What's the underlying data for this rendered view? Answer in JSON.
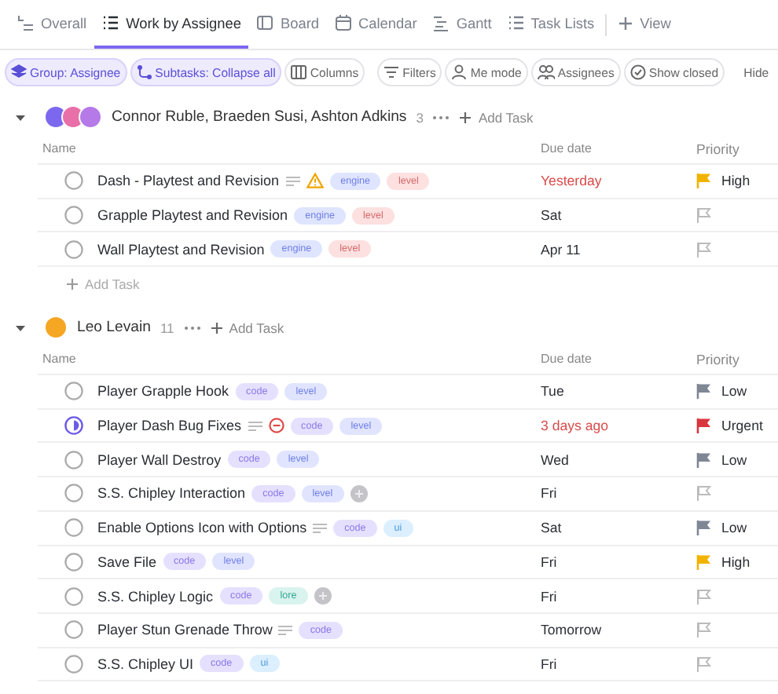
{
  "tabs": [
    {
      "label": "Overall",
      "selected": false
    },
    {
      "label": "Work by Assignee",
      "selected": true
    },
    {
      "label": "Board",
      "selected": false
    },
    {
      "label": "Calendar",
      "selected": false
    },
    {
      "label": "Gantt",
      "selected": false
    },
    {
      "label": "Task Lists",
      "selected": false
    },
    {
      "label": "View",
      "selected": false
    }
  ],
  "toolbar": [
    {
      "label": "Group: Assignee",
      "selected": true
    },
    {
      "label": "Subtasks: Collapse all",
      "selected": true
    },
    {
      "label": "Columns",
      "selected": false
    },
    {
      "label": "Filters",
      "selected": false
    },
    {
      "label": "Me mode",
      "selected": false
    },
    {
      "label": "Assignees",
      "selected": false
    },
    {
      "label": "Show closed",
      "selected": false
    }
  ],
  "hide_button": "Hide",
  "groups": [
    {
      "name": "Connor Ruble, Braeden Susi, Ashton Adkins",
      "count": "3",
      "expanded": true,
      "avatars": [
        {
          "color": "#7b68ee"
        },
        {
          "color": "#e96fa8"
        },
        {
          "color": "#b57ae8"
        }
      ],
      "add_label": "Add Task",
      "columns": [
        "Name",
        "Due date",
        "Priority"
      ],
      "tasks": [
        {
          "name": "Dash - Playtest and Revision",
          "in_progress": false,
          "has_description": true,
          "warning": true,
          "blocked": false,
          "has_more_tags": false,
          "tags": [
            {
              "text": "engine",
              "color": "#dfe5ff"
            },
            {
              "text": "level",
              "color": "#fde0e0"
            }
          ],
          "due": "Yesterday",
          "overdue": true,
          "priority": {
            "label": "High",
            "color": "#f2b300"
          }
        },
        {
          "name": "Grapple Playtest and Revision",
          "in_progress": false,
          "has_description": false,
          "warning": false,
          "blocked": false,
          "has_more_tags": false,
          "tags": [
            {
              "text": "engine",
              "color": "#dfe5ff"
            },
            {
              "text": "level",
              "color": "#fde0e0"
            }
          ],
          "due": "Sat",
          "overdue": false
        },
        {
          "name": "Wall Playtest and Revision",
          "in_progress": false,
          "has_description": false,
          "warning": false,
          "blocked": false,
          "has_more_tags": false,
          "tags": [
            {
              "text": "engine",
              "color": "#dfe5ff"
            },
            {
              "text": "level",
              "color": "#fde0e0"
            }
          ],
          "due": "Apr 11",
          "overdue": false
        }
      ],
      "footer_add": "Add Task"
    },
    {
      "name": "Leo Levain",
      "count": "11",
      "expanded": true,
      "avatars": [
        {
          "color": "#f5a623"
        }
      ],
      "add_label": "Add Task",
      "columns": [
        "Name",
        "Due date",
        "Priority"
      ],
      "tasks": [
        {
          "name": "Player Grapple Hook",
          "in_progress": false,
          "has_description": false,
          "warning": false,
          "blocked": false,
          "has_more_tags": false,
          "tags": [
            {
              "text": "code",
              "color": "#e6e0ff"
            },
            {
              "text": "level",
              "color": "#e0e4ff"
            }
          ],
          "due": "Tue",
          "overdue": false,
          "priority": {
            "label": "Low",
            "color": "#7f8694"
          }
        },
        {
          "name": "Player Dash Bug Fixes",
          "in_progress": true,
          "has_description": true,
          "warning": false,
          "blocked": true,
          "has_more_tags": false,
          "tags": [
            {
              "text": "code",
              "color": "#e6e0ff"
            },
            {
              "text": "level",
              "color": "#e0e4ff"
            }
          ],
          "due": "3 days ago",
          "overdue": true,
          "priority": {
            "label": "Urgent",
            "color": "#d9363e"
          }
        },
        {
          "name": "Player Wall Destroy",
          "in_progress": false,
          "has_description": false,
          "warning": false,
          "blocked": false,
          "has_more_tags": false,
          "tags": [
            {
              "text": "code",
              "color": "#e6e0ff"
            },
            {
              "text": "level",
              "color": "#e0e4ff"
            }
          ],
          "due": "Wed",
          "overdue": false,
          "priority": {
            "label": "Low",
            "color": "#7f8694"
          }
        },
        {
          "name": "S.S. Chipley Interaction",
          "in_progress": false,
          "has_description": false,
          "warning": false,
          "blocked": false,
          "has_more_tags": true,
          "tags": [
            {
              "text": "code",
              "color": "#e6e0ff"
            },
            {
              "text": "level",
              "color": "#e0e4ff"
            }
          ],
          "due": "Fri",
          "overdue": false
        },
        {
          "name": "Enable Options Icon with Options",
          "in_progress": false,
          "has_description": true,
          "warning": false,
          "blocked": false,
          "has_more_tags": false,
          "tags": [
            {
              "text": "code",
              "color": "#e6e0ff"
            },
            {
              "text": "ui",
              "color": "#dcefff"
            }
          ],
          "due": "Sat",
          "overdue": false,
          "priority": {
            "label": "Low",
            "color": "#7f8694"
          }
        },
        {
          "name": "Save File",
          "in_progress": false,
          "has_description": false,
          "warning": false,
          "blocked": false,
          "has_more_tags": false,
          "tags": [
            {
              "text": "code",
              "color": "#e6e0ff"
            },
            {
              "text": "level",
              "color": "#e0e4ff"
            }
          ],
          "due": "Fri",
          "overdue": false,
          "priority": {
            "label": "High",
            "color": "#f2b300"
          }
        },
        {
          "name": "S.S. Chipley Logic",
          "in_progress": false,
          "has_description": false,
          "warning": false,
          "blocked": false,
          "has_more_tags": true,
          "tags": [
            {
              "text": "code",
              "color": "#e6e0ff"
            },
            {
              "text": "lore",
              "color": "#d9f3ee"
            }
          ],
          "due": "Fri",
          "overdue": false
        },
        {
          "name": "Player Stun Grenade Throw",
          "in_progress": false,
          "has_description": true,
          "warning": false,
          "blocked": false,
          "has_more_tags": false,
          "tags": [
            {
              "text": "code",
              "color": "#e6e0ff"
            }
          ],
          "due": "Tomorrow",
          "overdue": false
        },
        {
          "name": "S.S. Chipley UI",
          "in_progress": false,
          "has_description": false,
          "warning": false,
          "blocked": false,
          "has_more_tags": false,
          "tags": [
            {
              "text": "code",
              "color": "#e6e0ff"
            },
            {
              "text": "ui",
              "color": "#dcefff"
            }
          ],
          "due": "Fri",
          "overdue": false
        }
      ]
    }
  ]
}
